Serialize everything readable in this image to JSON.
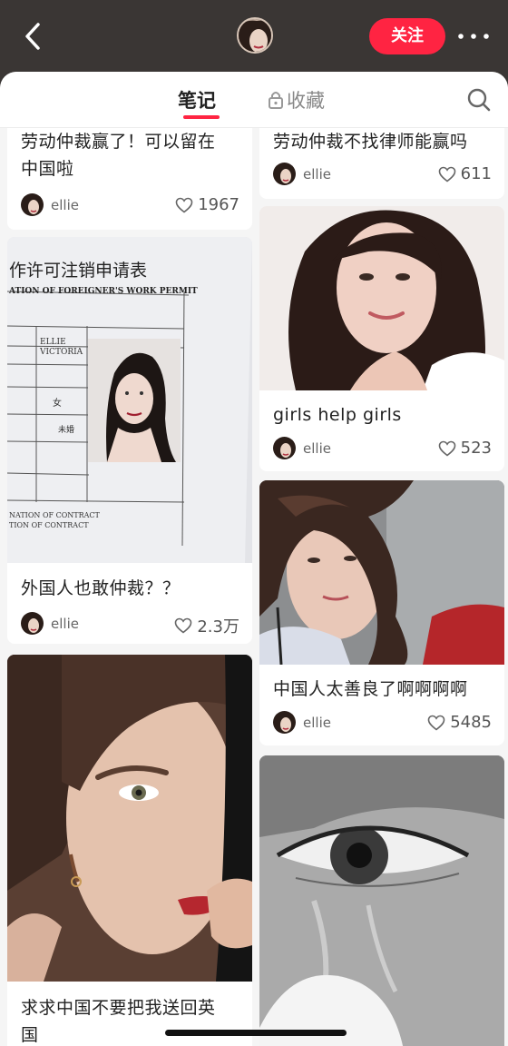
{
  "header": {
    "follow_label": "关注",
    "back_icon": "chevron-left-icon",
    "more_icon": "more-dots-icon"
  },
  "tabs": {
    "notes": "笔记",
    "collections": "收藏",
    "search_icon": "search-icon",
    "lock_icon": "lock-icon"
  },
  "colors": {
    "accent": "#ff2442",
    "topbar_bg": "#3a3634",
    "feed_bg": "#f5f5f5"
  },
  "feed": {
    "left": [
      {
        "title_line1": "劳动仲裁赢了！可以留在",
        "title_line2": "中国啦",
        "author": "ellie",
        "likes": "1967"
      },
      {
        "title": "外国人也敢仲裁？？",
        "author": "ellie",
        "likes": "2.3万",
        "doc_heading": "作许可注销申请表",
        "doc_subheading": "ATION OF FOREIGNER'S WORK PERMIT",
        "doc_name_value": "ELLIE VICTORIA",
        "doc_gender": "女",
        "doc_status": "未婚",
        "doc_footer1": "NATION OF CONTRACT",
        "doc_footer2": "TION OF CONTRACT"
      },
      {
        "title_line1": "求求中国不要把我送回英",
        "title_line2": "国"
      }
    ],
    "right": [
      {
        "title": "劳动仲裁不找律师能赢吗",
        "author": "ellie",
        "likes": "611"
      },
      {
        "title": "girls help girls",
        "author": "ellie",
        "likes": "523"
      },
      {
        "title": "中国人太善良了啊啊啊啊",
        "author": "ellie",
        "likes": "5485"
      },
      {
        "image_only": true
      }
    ]
  }
}
